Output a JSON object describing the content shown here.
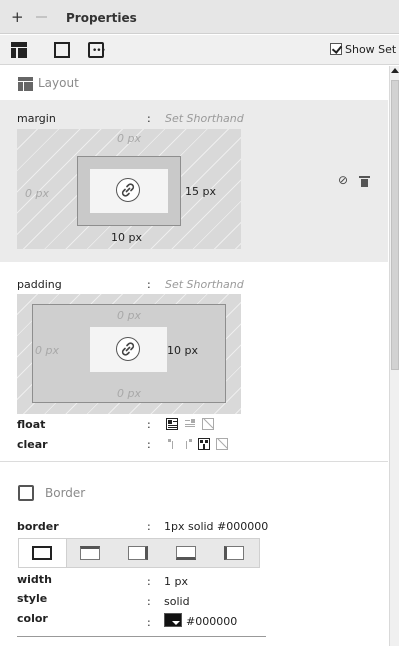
{
  "titlebar": {
    "plus": "+",
    "title": "Properties"
  },
  "toolbar": {
    "show_set_label": "Show Set"
  },
  "layout_section": {
    "label": "Layout"
  },
  "margin": {
    "label": "margin",
    "colon": ":",
    "shorthand": "Set Shorthand",
    "top": "0 px",
    "left": "0 px",
    "right": "15 px",
    "bottom": "10 px"
  },
  "padding": {
    "label": "padding",
    "colon": ":",
    "shorthand": "Set Shorthand",
    "top": "0 px",
    "left": "0 px",
    "right": "10 px",
    "bottom": "0 px"
  },
  "float": {
    "label": "float",
    "colon": ":"
  },
  "clear": {
    "label": "clear",
    "colon": ":"
  },
  "border_section": {
    "label": "Border"
  },
  "border": {
    "label": "border",
    "colon": ":",
    "value": "1px solid #000000",
    "width_label": "width",
    "width_value": "1 px",
    "style_label": "style",
    "style_value": "solid",
    "color_label": "color",
    "color_value": "#000000"
  },
  "colors": {
    "swatch": "#000000",
    "panel_bg": "#ebebeb"
  }
}
